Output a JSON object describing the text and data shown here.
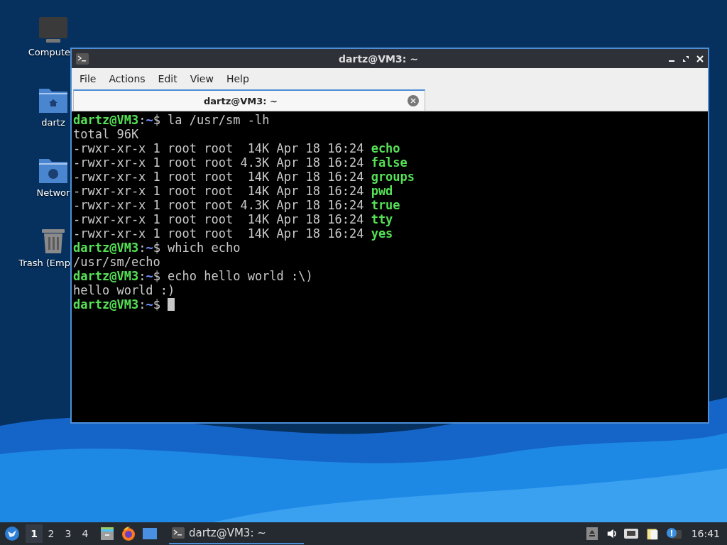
{
  "desktop_icons": [
    {
      "kind": "computer",
      "label": "Compute"
    },
    {
      "kind": "home",
      "label": "dartz"
    },
    {
      "kind": "network",
      "label": "Networ"
    },
    {
      "kind": "trash",
      "label": "Trash (Emp"
    }
  ],
  "window": {
    "title": "dartz@VM3: ~",
    "menu": [
      "File",
      "Actions",
      "Edit",
      "View",
      "Help"
    ],
    "tabs": [
      {
        "label": "dartz@VM3: ~",
        "selected": true
      }
    ],
    "terminal": {
      "lines": [
        [
          {
            "kind": "user",
            "text": "dartz@VM3"
          },
          {
            "kind": "plain",
            "text": ":"
          },
          {
            "kind": "path",
            "text": "~"
          },
          {
            "kind": "plain",
            "text": "$ la /usr/sm -lh"
          }
        ],
        [
          {
            "kind": "plain",
            "text": "total 96K"
          }
        ],
        [
          {
            "kind": "plain",
            "text": "-rwxr-xr-x 1 root root  14K Apr 18 16:24 "
          },
          {
            "kind": "exec",
            "text": "echo"
          }
        ],
        [
          {
            "kind": "plain",
            "text": "-rwxr-xr-x 1 root root 4.3K Apr 18 16:24 "
          },
          {
            "kind": "exec",
            "text": "false"
          }
        ],
        [
          {
            "kind": "plain",
            "text": "-rwxr-xr-x 1 root root  14K Apr 18 16:24 "
          },
          {
            "kind": "exec",
            "text": "groups"
          }
        ],
        [
          {
            "kind": "plain",
            "text": "-rwxr-xr-x 1 root root  14K Apr 18 16:24 "
          },
          {
            "kind": "exec",
            "text": "pwd"
          }
        ],
        [
          {
            "kind": "plain",
            "text": "-rwxr-xr-x 1 root root 4.3K Apr 18 16:24 "
          },
          {
            "kind": "exec",
            "text": "true"
          }
        ],
        [
          {
            "kind": "plain",
            "text": "-rwxr-xr-x 1 root root  14K Apr 18 16:24 "
          },
          {
            "kind": "exec",
            "text": "tty"
          }
        ],
        [
          {
            "kind": "plain",
            "text": "-rwxr-xr-x 1 root root  14K Apr 18 16:24 "
          },
          {
            "kind": "exec",
            "text": "yes"
          }
        ],
        [
          {
            "kind": "user",
            "text": "dartz@VM3"
          },
          {
            "kind": "plain",
            "text": ":"
          },
          {
            "kind": "path",
            "text": "~"
          },
          {
            "kind": "plain",
            "text": "$ which echo"
          }
        ],
        [
          {
            "kind": "plain",
            "text": "/usr/sm/echo"
          }
        ],
        [
          {
            "kind": "user",
            "text": "dartz@VM3"
          },
          {
            "kind": "plain",
            "text": ":"
          },
          {
            "kind": "path",
            "text": "~"
          },
          {
            "kind": "plain",
            "text": "$ echo hello world :\\)"
          }
        ],
        [
          {
            "kind": "plain",
            "text": "hello world :)"
          }
        ],
        [
          {
            "kind": "user",
            "text": "dartz@VM3"
          },
          {
            "kind": "plain",
            "text": ":"
          },
          {
            "kind": "path",
            "text": "~"
          },
          {
            "kind": "plain",
            "text": "$"
          },
          {
            "kind": "cursor"
          }
        ]
      ]
    }
  },
  "taskbar": {
    "workspaces": [
      {
        "label": "1",
        "selected": true
      },
      {
        "label": "2",
        "selected": false
      },
      {
        "label": "3",
        "selected": false
      },
      {
        "label": "4",
        "selected": false
      }
    ],
    "tasks": [
      {
        "label": "dartz@VM3: ~",
        "selected": true
      }
    ],
    "clock": "16:41"
  }
}
